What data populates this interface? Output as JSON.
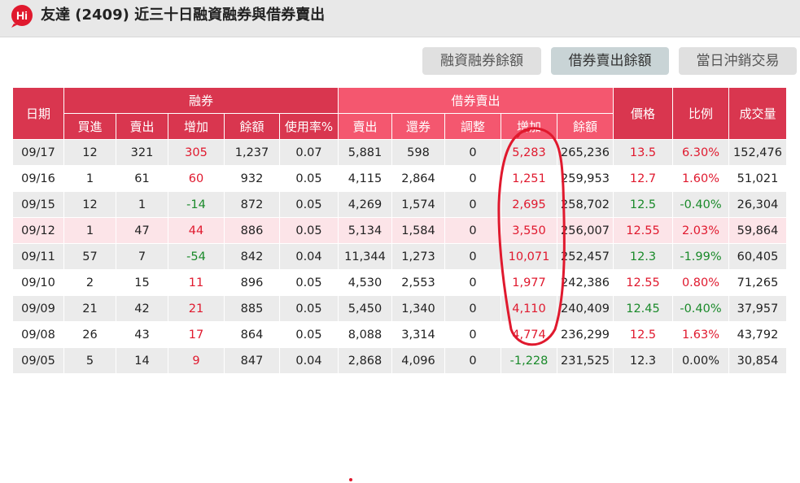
{
  "header": {
    "title": "友達 (2409) 近三十日融資融券與借券賣出",
    "logo_text": "Hi"
  },
  "tabs": [
    {
      "label": "融資融券餘額",
      "active": false
    },
    {
      "label": "借券賣出餘額",
      "active": true
    },
    {
      "label": "當日沖銷交易",
      "active": false
    }
  ],
  "table": {
    "groups": {
      "date": "日期",
      "margin": "融券",
      "lending": "借券賣出",
      "price": "價格",
      "ratio": "比例",
      "volume": "成交量"
    },
    "margin_cols": [
      "買進",
      "賣出",
      "增加",
      "餘額",
      "使用率%"
    ],
    "lending_cols": [
      "賣出",
      "還券",
      "調整",
      "增加",
      "餘額"
    ],
    "rows": [
      {
        "date": "09/17",
        "buy": "12",
        "sell": "321",
        "inc": "305",
        "bal": "1,237",
        "usage": "0.07",
        "l_sell": "5,881",
        "l_return": "598",
        "l_adj": "0",
        "l_inc": "5,283",
        "l_bal": "265,236",
        "price": "13.5",
        "ratio": "6.30%",
        "volume": "152,476",
        "inc_color": "red",
        "l_inc_color": "red",
        "price_color": "red"
      },
      {
        "date": "09/16",
        "buy": "1",
        "sell": "61",
        "inc": "60",
        "bal": "932",
        "usage": "0.05",
        "l_sell": "4,115",
        "l_return": "2,864",
        "l_adj": "0",
        "l_inc": "1,251",
        "l_bal": "259,953",
        "price": "12.7",
        "ratio": "1.60%",
        "volume": "51,021",
        "inc_color": "red",
        "l_inc_color": "red",
        "price_color": "red"
      },
      {
        "date": "09/15",
        "buy": "12",
        "sell": "1",
        "inc": "-14",
        "bal": "872",
        "usage": "0.05",
        "l_sell": "4,269",
        "l_return": "1,574",
        "l_adj": "0",
        "l_inc": "2,695",
        "l_bal": "258,702",
        "price": "12.5",
        "ratio": "-0.40%",
        "volume": "26,304",
        "inc_color": "green",
        "l_inc_color": "red",
        "price_color": "green"
      },
      {
        "date": "09/12",
        "buy": "1",
        "sell": "47",
        "inc": "44",
        "bal": "886",
        "usage": "0.05",
        "l_sell": "5,134",
        "l_return": "1,584",
        "l_adj": "0",
        "l_inc": "3,550",
        "l_bal": "256,007",
        "price": "12.55",
        "ratio": "2.03%",
        "volume": "59,864",
        "inc_color": "red",
        "l_inc_color": "red",
        "price_color": "red"
      },
      {
        "date": "09/11",
        "buy": "57",
        "sell": "7",
        "inc": "-54",
        "bal": "842",
        "usage": "0.04",
        "l_sell": "11,344",
        "l_return": "1,273",
        "l_adj": "0",
        "l_inc": "10,071",
        "l_bal": "252,457",
        "price": "12.3",
        "ratio": "-1.99%",
        "volume": "60,405",
        "inc_color": "green",
        "l_inc_color": "red",
        "price_color": "green"
      },
      {
        "date": "09/10",
        "buy": "2",
        "sell": "15",
        "inc": "11",
        "bal": "896",
        "usage": "0.05",
        "l_sell": "4,530",
        "l_return": "2,553",
        "l_adj": "0",
        "l_inc": "1,977",
        "l_bal": "242,386",
        "price": "12.55",
        "ratio": "0.80%",
        "volume": "71,265",
        "inc_color": "red",
        "l_inc_color": "red",
        "price_color": "red"
      },
      {
        "date": "09/09",
        "buy": "21",
        "sell": "42",
        "inc": "21",
        "bal": "885",
        "usage": "0.05",
        "l_sell": "5,450",
        "l_return": "1,340",
        "l_adj": "0",
        "l_inc": "4,110",
        "l_bal": "240,409",
        "price": "12.45",
        "ratio": "-0.40%",
        "volume": "37,957",
        "inc_color": "red",
        "l_inc_color": "red",
        "price_color": "green"
      },
      {
        "date": "09/08",
        "buy": "26",
        "sell": "43",
        "inc": "17",
        "bal": "864",
        "usage": "0.05",
        "l_sell": "8,088",
        "l_return": "3,314",
        "l_adj": "0",
        "l_inc": "4,774",
        "l_bal": "236,299",
        "price": "12.5",
        "ratio": "1.63%",
        "volume": "43,792",
        "inc_color": "red",
        "l_inc_color": "red",
        "price_color": "red"
      },
      {
        "date": "09/05",
        "buy": "5",
        "sell": "14",
        "inc": "9",
        "bal": "847",
        "usage": "0.04",
        "l_sell": "2,868",
        "l_return": "4,096",
        "l_adj": "0",
        "l_inc": "-1,228",
        "l_bal": "231,525",
        "price": "12.3",
        "ratio": "0.00%",
        "volume": "30,854",
        "inc_color": "red",
        "l_inc_color": "green",
        "price_color": ""
      }
    ]
  },
  "colors": {
    "header_red": "#d9364f",
    "header_pink": "#f4576f",
    "up": "#e0192e",
    "down": "#1a8a2a",
    "annotation": "#e0192e"
  },
  "annotation": {
    "type": "hand-drawn circle around lending 增加 column"
  }
}
